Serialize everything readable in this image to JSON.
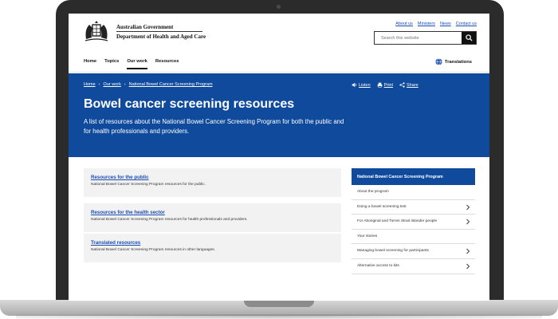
{
  "header": {
    "gov_name": "Australian Government",
    "dept_name": "Department of Health and Aged Care",
    "top_links": [
      "About us",
      "Ministers",
      "News",
      "Contact us"
    ],
    "search_placeholder": "Search this website"
  },
  "nav": {
    "items": [
      "Home",
      "Topics",
      "Our work",
      "Resources"
    ],
    "active": "Our work",
    "translations": "Translations"
  },
  "hero": {
    "breadcrumb": [
      "Home",
      "Our work",
      "National Bowel Cancer Screening Program"
    ],
    "tools": [
      "Listen",
      "Print",
      "Share"
    ],
    "title": "Bowel cancer screening resources",
    "description": "A list of resources about the National Bowel Cancer Screening Program for both the public and for health professionals and providers."
  },
  "cards": [
    {
      "title": "Resources for the public",
      "desc": "National Bowel Cancer Screening Program resources for the public."
    },
    {
      "title": "Resources for the health sector",
      "desc": "National Bowel Cancer Screening Program resources for health professionals and providers."
    },
    {
      "title": "Translated resources",
      "desc": "National Bowel Cancer Screening Program resources in other languages."
    }
  ],
  "sidenav": {
    "heading": "National Bowel Cancer Screening Program",
    "items": [
      {
        "label": "About the program",
        "chevron": false
      },
      {
        "label": "Doing a bowel screening test",
        "chevron": true
      },
      {
        "label": "For Aboriginal and Torres Strait Islander people",
        "chevron": true
      },
      {
        "label": "Your stories",
        "chevron": false
      },
      {
        "label": "Managing bowel screening for participants",
        "chevron": true
      },
      {
        "label": "Alternative access to kits",
        "chevron": true
      }
    ]
  },
  "colors": {
    "brand_blue": "#0f4a9c",
    "link_blue": "#1a4db3"
  }
}
